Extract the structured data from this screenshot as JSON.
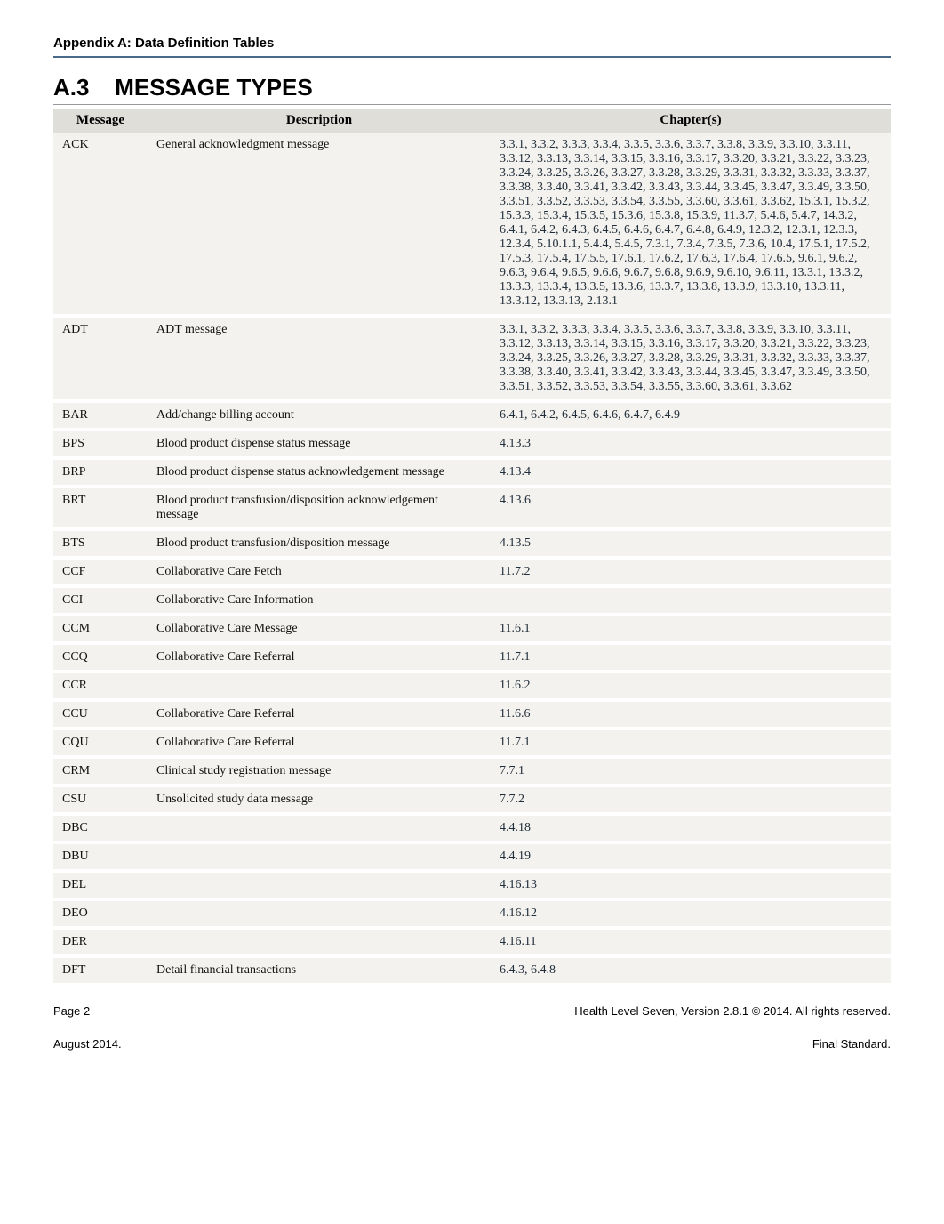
{
  "header": {
    "appendix_title": "Appendix A: Data Definition Tables"
  },
  "section": {
    "number": "A.3",
    "title": "MESSAGE TYPES"
  },
  "columns": {
    "message": "Message",
    "description": "Description",
    "chapters": "Chapter(s)"
  },
  "rows": [
    {
      "msg": "ACK",
      "desc": "General acknowledgment message",
      "chapters": "3.3.1, 3.3.2, 3.3.3, 3.3.4, 3.3.5, 3.3.6, 3.3.7, 3.3.8, 3.3.9, 3.3.10, 3.3.11, 3.3.12, 3.3.13, 3.3.14, 3.3.15, 3.3.16, 3.3.17, 3.3.20, 3.3.21, 3.3.22, 3.3.23, 3.3.24, 3.3.25, 3.3.26, 3.3.27, 3.3.28, 3.3.29, 3.3.31, 3.3.32, 3.3.33, 3.3.37, 3.3.38, 3.3.40, 3.3.41, 3.3.42, 3.3.43, 3.3.44, 3.3.45, 3.3.47, 3.3.49, 3.3.50, 3.3.51, 3.3.52, 3.3.53, 3.3.54, 3.3.55, 3.3.60, 3.3.61, 3.3.62, 15.3.1, 15.3.2, 15.3.3, 15.3.4, 15.3.5, 15.3.6, 15.3.8, 15.3.9, 11.3.7, 5.4.6, 5.4.7, 14.3.2, 6.4.1, 6.4.2, 6.4.3, 6.4.5, 6.4.6, 6.4.7, 6.4.8, 6.4.9, 12.3.2, 12.3.1, 12.3.3, 12.3.4, 5.10.1.1, 5.4.4, 5.4.5, 7.3.1, 7.3.4, 7.3.5, 7.3.6, 10.4, 17.5.1, 17.5.2, 17.5.3, 17.5.4, 17.5.5, 17.6.1, 17.6.2, 17.6.3, 17.6.4, 17.6.5, 9.6.1, 9.6.2, 9.6.3, 9.6.4, 9.6.5, 9.6.6, 9.6.7, 9.6.8, 9.6.9, 9.6.10, 9.6.11, 13.3.1, 13.3.2, 13.3.3, 13.3.4, 13.3.5, 13.3.6, 13.3.7, 13.3.8, 13.3.9, 13.3.10, 13.3.11, 13.3.12, 13.3.13, 2.13.1"
    },
    {
      "msg": "ADT",
      "desc": "ADT message",
      "chapters": "3.3.1, 3.3.2, 3.3.3, 3.3.4, 3.3.5, 3.3.6, 3.3.7, 3.3.8, 3.3.9, 3.3.10, 3.3.11, 3.3.12, 3.3.13, 3.3.14, 3.3.15, 3.3.16, 3.3.17, 3.3.20, 3.3.21, 3.3.22, 3.3.23, 3.3.24, 3.3.25, 3.3.26, 3.3.27, 3.3.28, 3.3.29, 3.3.31, 3.3.32, 3.3.33, 3.3.37, 3.3.38, 3.3.40, 3.3.41, 3.3.42, 3.3.43, 3.3.44, 3.3.45, 3.3.47, 3.3.49, 3.3.50, 3.3.51, 3.3.52, 3.3.53, 3.3.54, 3.3.55, 3.3.60, 3.3.61, 3.3.62"
    },
    {
      "msg": "BAR",
      "desc": "Add/change billing account",
      "chapters": "6.4.1, 6.4.2, 6.4.5, 6.4.6, 6.4.7, 6.4.9"
    },
    {
      "msg": "BPS",
      "desc": "Blood product dispense status message",
      "chapters": "4.13.3"
    },
    {
      "msg": "BRP",
      "desc": "Blood product dispense status acknowledgement message",
      "chapters": "4.13.4"
    },
    {
      "msg": "BRT",
      "desc": "Blood product transfusion/disposition acknowledgement message",
      "chapters": "4.13.6"
    },
    {
      "msg": "BTS",
      "desc": "Blood product transfusion/disposition message",
      "chapters": "4.13.5"
    },
    {
      "msg": "CCF",
      "desc": "Collaborative Care Fetch",
      "chapters": "11.7.2"
    },
    {
      "msg": "CCI",
      "desc": "Collaborative Care Information",
      "chapters": ""
    },
    {
      "msg": "CCM",
      "desc": "Collaborative Care Message",
      "chapters": "11.6.1"
    },
    {
      "msg": "CCQ",
      "desc": "Collaborative Care Referral",
      "chapters": "11.7.1"
    },
    {
      "msg": "CCR",
      "desc": "",
      "chapters": "11.6.2"
    },
    {
      "msg": "CCU",
      "desc": "Collaborative Care Referral",
      "chapters": "11.6.6"
    },
    {
      "msg": "CQU",
      "desc": "Collaborative Care Referral",
      "chapters": "11.7.1"
    },
    {
      "msg": "CRM",
      "desc": "Clinical study registration message",
      "chapters": "7.7.1"
    },
    {
      "msg": "CSU",
      "desc": "Unsolicited study data message",
      "chapters": "7.7.2"
    },
    {
      "msg": "DBC",
      "desc": "",
      "chapters": "4.4.18"
    },
    {
      "msg": "DBU",
      "desc": "",
      "chapters": "4.4.19"
    },
    {
      "msg": "DEL",
      "desc": "",
      "chapters": "4.16.13"
    },
    {
      "msg": "DEO",
      "desc": "",
      "chapters": "4.16.12"
    },
    {
      "msg": "DER",
      "desc": "",
      "chapters": "4.16.11"
    },
    {
      "msg": "DFT",
      "desc": "Detail financial transactions",
      "chapters": "6.4.3, 6.4.8"
    }
  ],
  "footer": {
    "page": "Page 2",
    "copyright": "Health Level Seven, Version 2.8.1 © 2014.  All rights reserved.",
    "date": "August 2014.",
    "status": "Final Standard."
  }
}
